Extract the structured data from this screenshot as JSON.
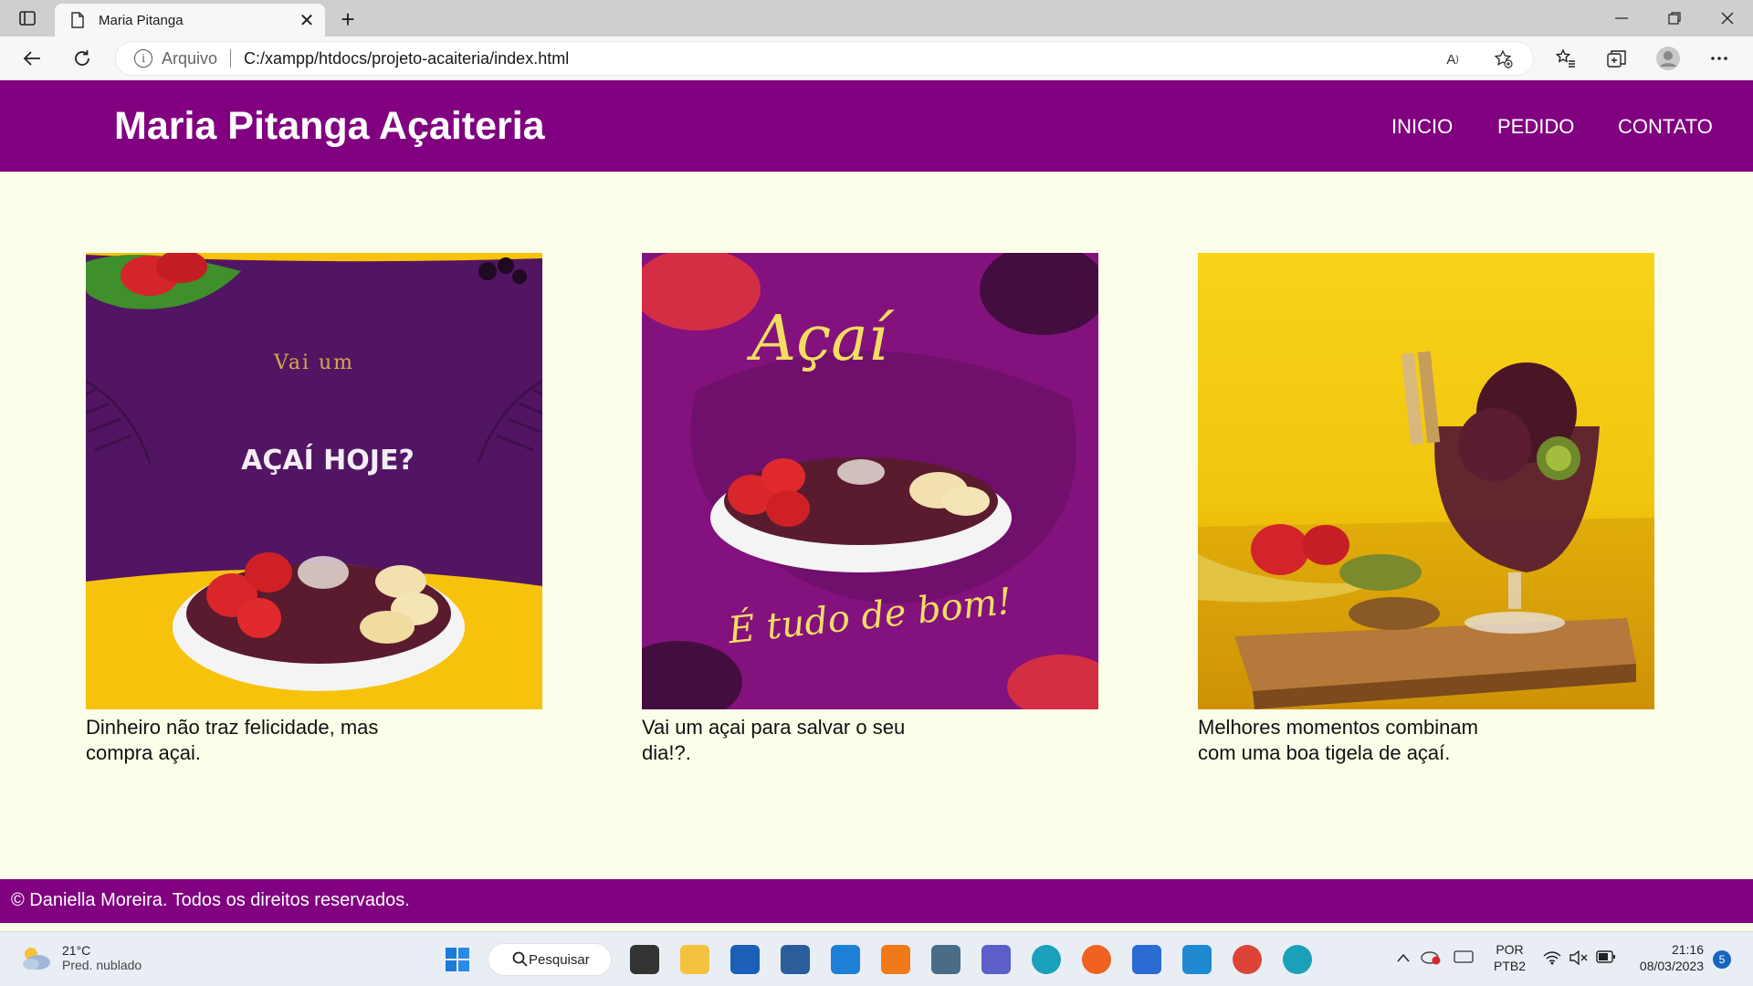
{
  "browser": {
    "tab_title": "Maria Pitanga",
    "address_protocol_label": "Arquivo",
    "address_url": "C:/xampp/htdocs/projeto-acaiteria/index.html"
  },
  "site": {
    "title": "Maria Pitanga Açaiteria",
    "nav": [
      "INICIO",
      "PEDIDO",
      "CONTATO"
    ],
    "cards": [
      {
        "image": {
          "top_text": "Vai um",
          "main_text": "AÇAÍ HOJE?"
        },
        "caption_line1": "Dinheiro não traz felicidade, mas",
        "caption_line2": "compra açai."
      },
      {
        "image": {
          "top_text": "Açaí",
          "bottom_text": "É tudo de bom!"
        },
        "caption_line1": "Vai um açai para salvar o seu",
        "caption_line2": "dia!?."
      },
      {
        "image": {},
        "caption_line1": "Melhores momentos combinam",
        "caption_line2": "com uma boa tigela de açaí."
      }
    ],
    "footer": "© Daniella Moreira. Todos os direitos reservados."
  },
  "taskbar": {
    "weather_temp": "21°C",
    "weather_desc": "Pred. nublado",
    "search_label": "Pesquisar",
    "lang_line1": "POR",
    "lang_line2": "PTB2",
    "time": "21:16",
    "date": "08/03/2023",
    "notification_count": "5"
  },
  "colors": {
    "brand_purple": "#800080",
    "page_bg": "#fdfee9"
  }
}
